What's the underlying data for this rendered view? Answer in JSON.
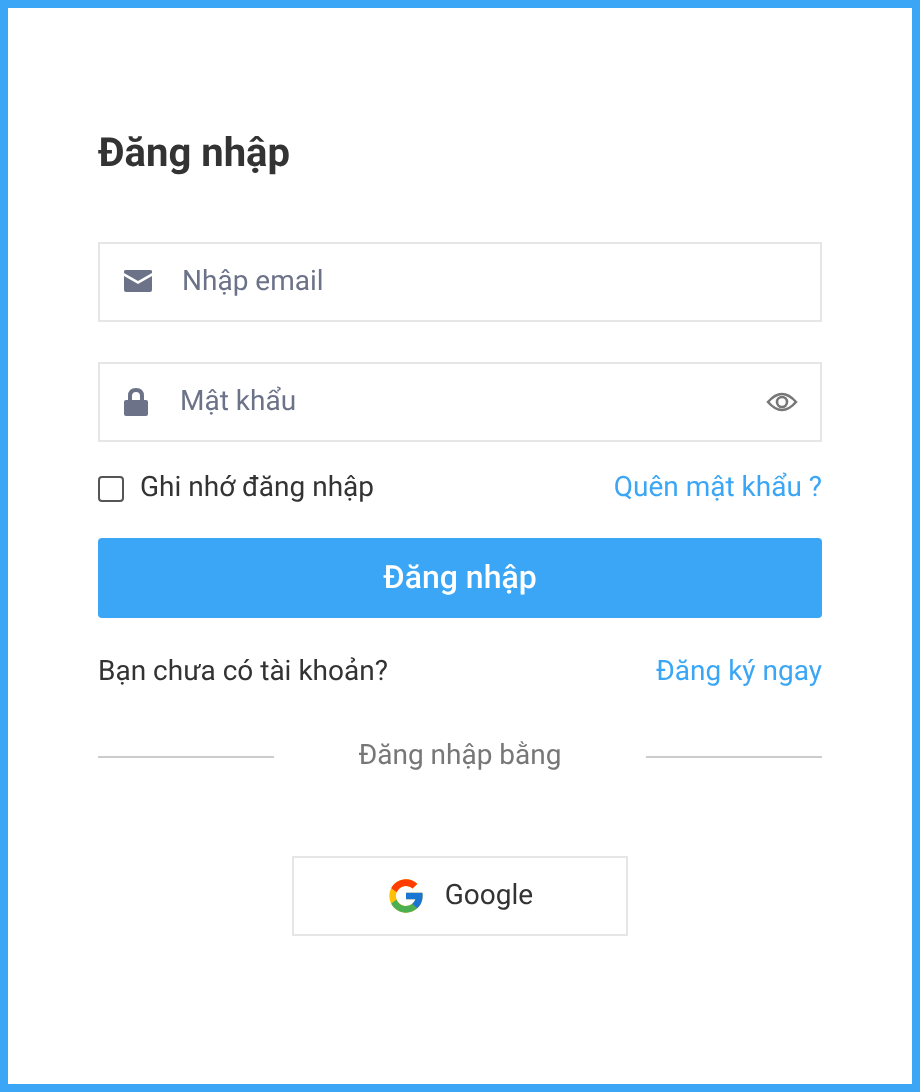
{
  "title": "Đăng nhập",
  "email": {
    "placeholder": "Nhập email"
  },
  "password": {
    "placeholder": "Mật khẩu"
  },
  "remember": {
    "label": "Ghi nhớ đăng nhập",
    "checked": false
  },
  "forgot_link": "Quên mật khẩu ?",
  "submit_button": "Đăng nhập",
  "signup_prompt": "Bạn chưa có tài khoản?",
  "signup_link": "Đăng ký ngay",
  "divider_text": "Đăng nhập bằng",
  "social_buttons": [
    {
      "label": "Google"
    }
  ]
}
